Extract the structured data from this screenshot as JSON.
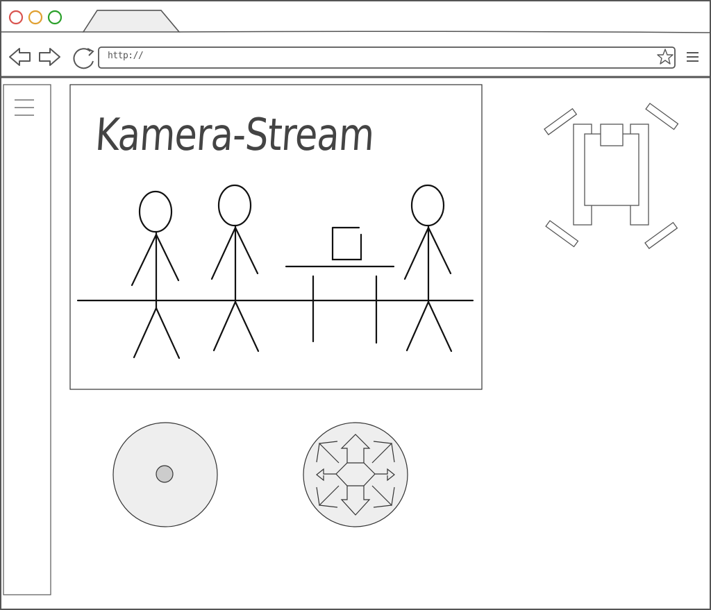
{
  "browser": {
    "address_bar": {
      "value": "http://"
    },
    "tab": {
      "label": ""
    },
    "window_buttons": {
      "close_color": "#d9534f",
      "minimize_color": "#e0a030",
      "maximize_color": "#2aa02a"
    },
    "icons": {
      "back": "back-arrow-icon",
      "forward": "forward-arrow-icon",
      "reload": "reload-icon",
      "bookmark": "star-icon",
      "menu": "hamburger-menu-icon"
    }
  },
  "sidebar": {
    "menu_icon": "hamburger-menu-icon"
  },
  "camera": {
    "title": "Kamera-Stream",
    "illustration": "camera-stream-placeholder"
  },
  "controls": {
    "joystick": {
      "icon": "joystick-icon"
    },
    "direction_pad": {
      "icon": "move-arrows-icon"
    }
  },
  "robot": {
    "icon": "robot-top-view-icon"
  }
}
